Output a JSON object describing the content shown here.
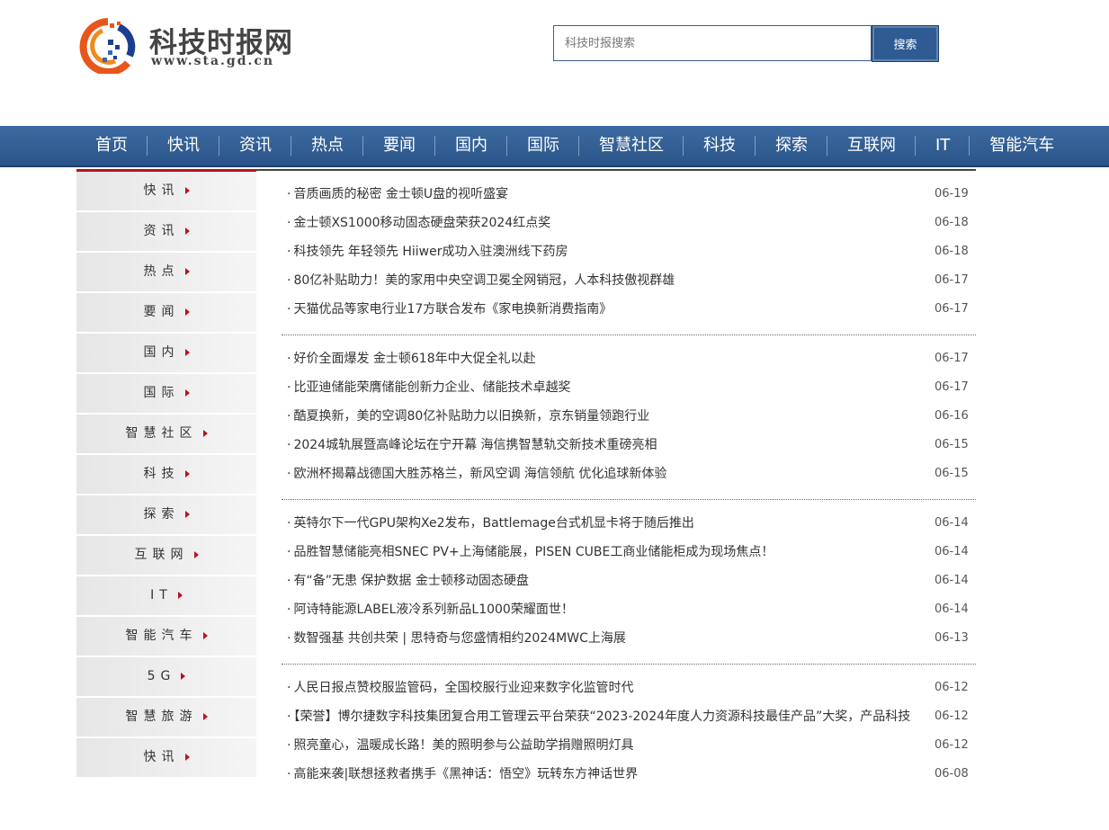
{
  "header": {
    "logo_title": "科技时报网",
    "logo_url": "www.sta.gd.cn"
  },
  "search": {
    "placeholder": "科技时报搜索",
    "button_label": "搜索"
  },
  "nav": {
    "items": [
      "首页",
      "快讯",
      "资讯",
      "热点",
      "要闻",
      "国内",
      "国际",
      "智慧社区",
      "科技",
      "探索",
      "互联网",
      "IT",
      "智能汽车"
    ]
  },
  "sidebar": {
    "items": [
      "快讯",
      "资讯",
      "热点",
      "要闻",
      "国内",
      "国际",
      "智慧社区",
      "科技",
      "探索",
      "互联网",
      "IT",
      "智能汽车",
      "5G",
      "智慧旅游",
      "快讯"
    ]
  },
  "news_groups": [
    [
      {
        "title": "音质画质的秘密 金士顿U盘的视听盛宴",
        "date": "06-19"
      },
      {
        "title": "金士顿XS1000移动固态硬盘荣获2024红点奖",
        "date": "06-18"
      },
      {
        "title": "科技领先 年轻领先 Hiiwer成功入驻澳洲线下药房",
        "date": "06-18"
      },
      {
        "title": "80亿补贴助力！美的家用中央空调卫冕全网销冠，人本科技傲视群雄",
        "date": "06-17"
      },
      {
        "title": "天猫优品等家电行业17方联合发布《家电换新消费指南》",
        "date": "06-17"
      }
    ],
    [
      {
        "title": "好价全面爆发 金士顿618年中大促全礼以赴",
        "date": "06-17"
      },
      {
        "title": "比亚迪储能荣膺储能创新力企业、储能技术卓越奖",
        "date": "06-17"
      },
      {
        "title": "酷夏换新，美的空调80亿补贴助力以旧换新，京东销量领跑行业",
        "date": "06-16"
      },
      {
        "title": "2024城轨展暨高峰论坛在宁开幕 海信携智慧轨交新技术重磅亮相",
        "date": "06-15"
      },
      {
        "title": "欧洲杯揭幕战德国大胜苏格兰，新风空调 海信领航 优化追球新体验",
        "date": "06-15"
      }
    ],
    [
      {
        "title": "英特尔下一代GPU架构Xe2发布，Battlemage台式机显卡将于随后推出",
        "date": "06-14"
      },
      {
        "title": "品胜智慧储能亮相SNEC PV+上海储能展，PISEN CUBE工商业储能柜成为现场焦点！",
        "date": "06-14"
      },
      {
        "title": "有“备”无患 保护数据 金士顿移动固态硬盘",
        "date": "06-14"
      },
      {
        "title": "阿诗特能源LABEL液冷系列新品L1000荣耀面世！",
        "date": "06-14"
      },
      {
        "title": "数智强基 共创共荣 | 思特奇与您盛情相约2024MWC上海展",
        "date": "06-13"
      }
    ],
    [
      {
        "title": "人民日报点赞校服监管码，全国校服行业迎来数字化监管时代",
        "date": "06-12"
      },
      {
        "title": "【荣誉】博尔捷数字科技集团复合用工管理云平台荣获“2023-2024年度人力资源科技最佳产品”大奖，产品科技",
        "date": "06-12"
      },
      {
        "title": "照亮童心，温暖成长路！美的照明参与公益助学捐赠照明灯具",
        "date": "06-12"
      },
      {
        "title": "高能来袭|联想拯救者携手《黑神话：悟空》玩转东方神话世界",
        "date": "06-08"
      }
    ]
  ]
}
